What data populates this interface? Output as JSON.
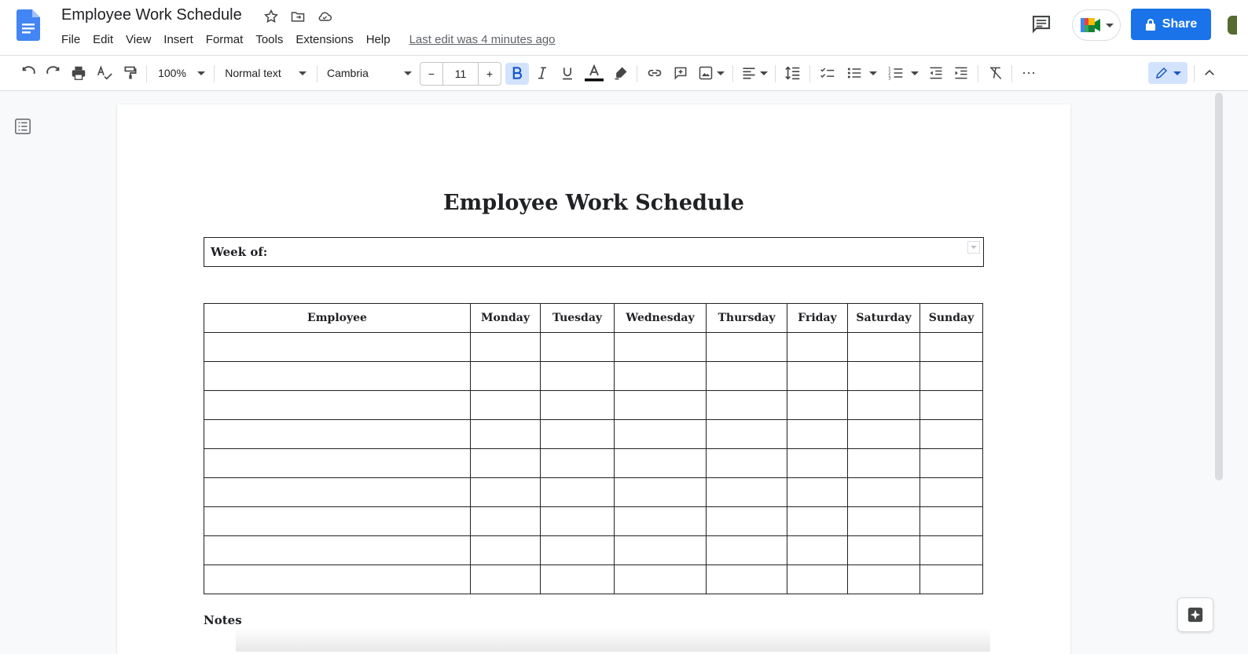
{
  "app": {
    "doc_title": "Employee Work Schedule",
    "menu": [
      "File",
      "Edit",
      "View",
      "Insert",
      "Format",
      "Tools",
      "Extensions",
      "Help"
    ],
    "last_edit": "Last edit was 4 minutes ago",
    "share_label": "Share",
    "brand_color": "#1a73e8"
  },
  "toolbar": {
    "zoom": "100%",
    "style": "Normal text",
    "font": "Cambria",
    "font_size": "11",
    "minus": "−",
    "plus": "+",
    "more": "⋯"
  },
  "document": {
    "heading": "Employee Work Schedule",
    "week_label": "Week of:",
    "table_headers": [
      "Employee",
      "Monday",
      "Tuesday",
      "Wednesday",
      "Thursday",
      "Friday",
      "Saturday",
      "Sunday"
    ],
    "notes_label": "Notes"
  }
}
